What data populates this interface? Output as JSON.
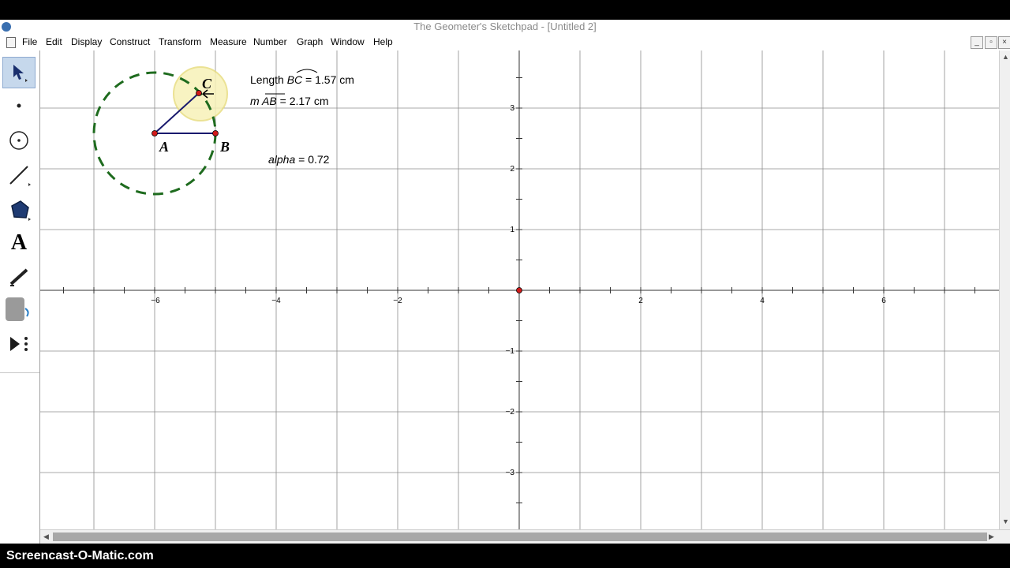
{
  "window": {
    "title": "The Geometer's Sketchpad - [Untitled 2]"
  },
  "menu": [
    "File",
    "Edit",
    "Display",
    "Construct",
    "Transform",
    "Measure",
    "Number",
    "Graph",
    "Window",
    "Help"
  ],
  "window_controls": {
    "minimize": "_",
    "restore": "▫",
    "close": "×"
  },
  "toolbox": [
    "arrow-select-tool",
    "point-tool",
    "compass-tool",
    "straightedge-tool",
    "polygon-tool",
    "text-tool",
    "marker-tool",
    "information-tool",
    "custom-tools"
  ],
  "text_tool_glyph": "A",
  "sketch": {
    "points": {
      "A": "A",
      "B": "B",
      "C": "C"
    },
    "measurements": {
      "arc_length_prefix": "Length ",
      "arc_length_name": "BC",
      "arc_length_value": " = 1.57 cm",
      "segment_prefix": "m ",
      "segment_name": "AB",
      "segment_value": " = 2.17 cm",
      "parameter_name": "alpha",
      "parameter_value": " = 0.72"
    },
    "axes": {
      "x_ticks": [
        "−6",
        "−4",
        "−2",
        "2",
        "4",
        "6"
      ],
      "y_ticks": [
        "3",
        "2",
        "1",
        "−1",
        "−2",
        "−3"
      ]
    }
  },
  "watermark": "Screencast-O-Matic.com",
  "colors": {
    "circle": "#1e6b1e",
    "segment": "#1a1a6e",
    "point": "#d11a1a",
    "highlight": "#f5efaa",
    "grid": "#8c8c8c"
  }
}
